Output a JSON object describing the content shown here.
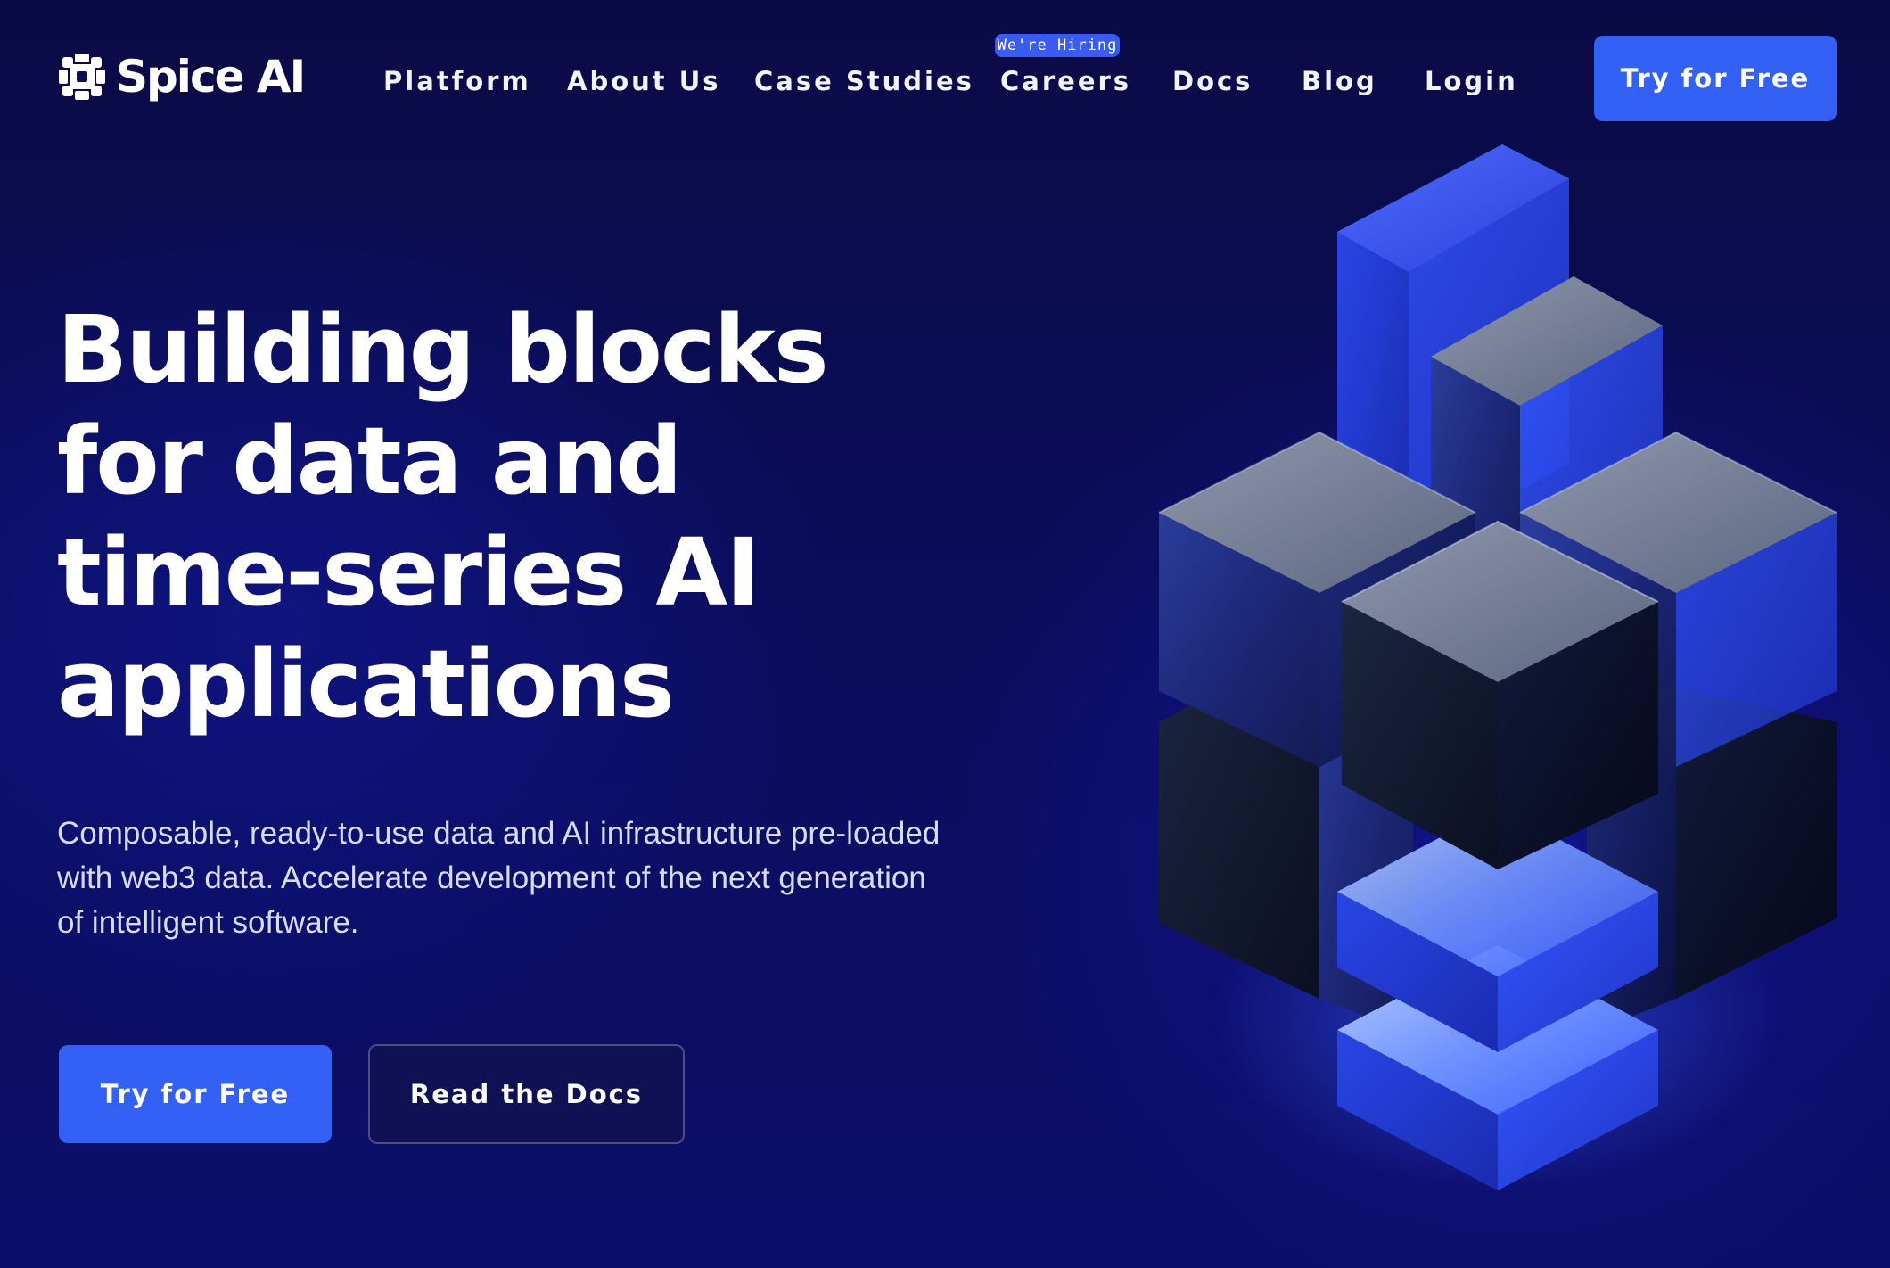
{
  "brand": {
    "name": "Spice AI"
  },
  "nav": {
    "items": [
      {
        "label": "Platform"
      },
      {
        "label": "About Us"
      },
      {
        "label": "Case Studies"
      },
      {
        "label": "Careers"
      },
      {
        "label": "Docs"
      },
      {
        "label": "Blog"
      },
      {
        "label": "Login"
      }
    ],
    "careers_badge": "We're Hiring",
    "cta": "Try for Free"
  },
  "hero": {
    "title": "Building blocks for data and time-series AI applications",
    "subtitle": "Composable, ready-to-use data and AI infrastructure pre-loaded with web3 data. Accelerate development of the next generation of intelligent software.",
    "primary_button": "Try for Free",
    "secondary_button": "Read the Docs"
  },
  "colors": {
    "background": "#0a0b4a",
    "accent": "#3461f5",
    "badge": "#3a5cf2"
  },
  "icons": {
    "logo": "spice-ai-logo-icon",
    "hero_art": "isometric-cubes-illustration"
  }
}
